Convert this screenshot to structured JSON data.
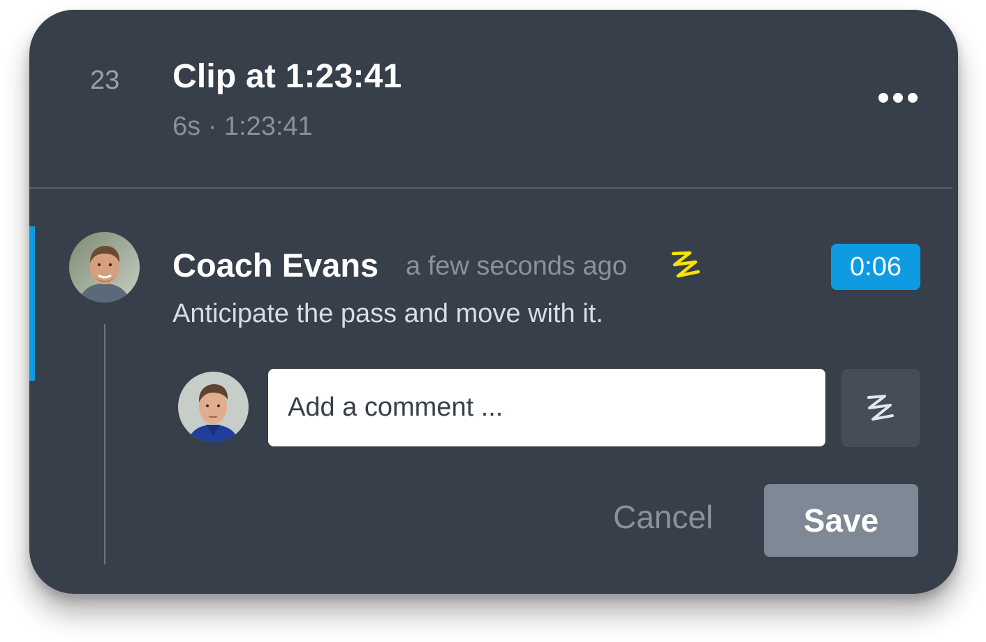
{
  "clip": {
    "index": "23",
    "title": "Clip at 1:23:41",
    "meta": "6s · 1:23:41"
  },
  "header": {
    "more_icon": "more-horizontal-icon"
  },
  "comment": {
    "author": "Coach Evans",
    "time": "a few seconds ago",
    "drawing_icon": "drawing-scribble-icon",
    "timestamp": "0:06",
    "text": "Anticipate the pass and move with it."
  },
  "reply": {
    "placeholder": "Add a comment ...",
    "value": "",
    "draw_icon": "drawing-scribble-icon",
    "cancel_label": "Cancel",
    "save_label": "Save"
  },
  "colors": {
    "card_bg": "#373f4a",
    "accent_blue": "#0e9be2",
    "drawing_yellow": "#f7e400",
    "save_button_bg": "#7f8895"
  }
}
